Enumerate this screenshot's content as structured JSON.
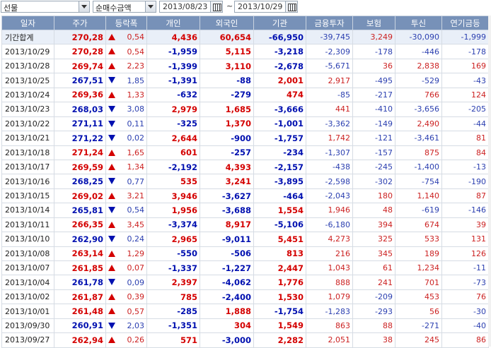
{
  "toolbar": {
    "market": "선물",
    "measure": "순매수금액",
    "start_date": "2013/08/23",
    "end_date": "2013/10/29",
    "range_sep": "~"
  },
  "table": {
    "headers": [
      "일자",
      "주가",
      "등락폭",
      "개인",
      "외국인",
      "기관",
      "금융투자",
      "보험",
      "투신",
      "연기금등"
    ],
    "colors": {
      "up": "#d40000",
      "down": "#0010b0",
      "header_bg": "#7791b8",
      "total_bg": "#e9eff8"
    },
    "rows": [
      {
        "date": "기간합계",
        "price": "270,28",
        "dir": "up",
        "chg": "0,54",
        "ind": "4,436",
        "for": "60,654",
        "inst": "-66,950",
        "fin": "-39,745",
        "ins": "3,249",
        "trust": "-30,090",
        "pension": "-1,999"
      },
      {
        "date": "2013/10/29",
        "price": "270,28",
        "dir": "up",
        "chg": "0,54",
        "ind": "-1,959",
        "for": "5,115",
        "inst": "-3,218",
        "fin": "-2,309",
        "ins": "-178",
        "trust": "-446",
        "pension": "-178"
      },
      {
        "date": "2013/10/28",
        "price": "269,74",
        "dir": "up",
        "chg": "2,23",
        "ind": "-1,399",
        "for": "3,110",
        "inst": "-2,678",
        "fin": "-5,671",
        "ins": "36",
        "trust": "2,838",
        "pension": "169"
      },
      {
        "date": "2013/10/25",
        "price": "267,51",
        "dir": "down",
        "chg": "1,85",
        "ind": "-1,391",
        "for": "-88",
        "inst": "2,001",
        "fin": "2,917",
        "ins": "-495",
        "trust": "-529",
        "pension": "-43"
      },
      {
        "date": "2013/10/24",
        "price": "269,36",
        "dir": "up",
        "chg": "1,33",
        "ind": "-632",
        "for": "-279",
        "inst": "474",
        "fin": "-85",
        "ins": "-217",
        "trust": "766",
        "pension": "124"
      },
      {
        "date": "2013/10/23",
        "price": "268,03",
        "dir": "down",
        "chg": "3,08",
        "ind": "2,979",
        "for": "1,685",
        "inst": "-3,666",
        "fin": "441",
        "ins": "-410",
        "trust": "-3,656",
        "pension": "-205"
      },
      {
        "date": "2013/10/22",
        "price": "271,11",
        "dir": "down",
        "chg": "0,11",
        "ind": "-325",
        "for": "1,370",
        "inst": "-1,001",
        "fin": "-3,362",
        "ins": "-149",
        "trust": "2,490",
        "pension": "-44"
      },
      {
        "date": "2013/10/21",
        "price": "271,22",
        "dir": "down",
        "chg": "0,02",
        "ind": "2,644",
        "for": "-900",
        "inst": "-1,757",
        "fin": "1,742",
        "ins": "-121",
        "trust": "-3,461",
        "pension": "81"
      },
      {
        "date": "2013/10/18",
        "price": "271,24",
        "dir": "up",
        "chg": "1,65",
        "ind": "601",
        "for": "-257",
        "inst": "-234",
        "fin": "-1,307",
        "ins": "-157",
        "trust": "875",
        "pension": "84"
      },
      {
        "date": "2013/10/17",
        "price": "269,59",
        "dir": "up",
        "chg": "1,34",
        "ind": "-2,192",
        "for": "4,393",
        "inst": "-2,157",
        "fin": "-438",
        "ins": "-245",
        "trust": "-1,400",
        "pension": "-13"
      },
      {
        "date": "2013/10/16",
        "price": "268,25",
        "dir": "down",
        "chg": "0,77",
        "ind": "535",
        "for": "3,241",
        "inst": "-3,895",
        "fin": "-2,598",
        "ins": "-302",
        "trust": "-754",
        "pension": "-190"
      },
      {
        "date": "2013/10/15",
        "price": "269,02",
        "dir": "up",
        "chg": "3,21",
        "ind": "3,946",
        "for": "-3,627",
        "inst": "-464",
        "fin": "-2,043",
        "ins": "180",
        "trust": "1,140",
        "pension": "87"
      },
      {
        "date": "2013/10/14",
        "price": "265,81",
        "dir": "down",
        "chg": "0,54",
        "ind": "1,956",
        "for": "-3,688",
        "inst": "1,554",
        "fin": "1,946",
        "ins": "48",
        "trust": "-619",
        "pension": "-146"
      },
      {
        "date": "2013/10/11",
        "price": "266,35",
        "dir": "up",
        "chg": "3,45",
        "ind": "-3,374",
        "for": "8,917",
        "inst": "-5,106",
        "fin": "-6,180",
        "ins": "394",
        "trust": "674",
        "pension": "39"
      },
      {
        "date": "2013/10/10",
        "price": "262,90",
        "dir": "down",
        "chg": "0,24",
        "ind": "2,965",
        "for": "-9,011",
        "inst": "5,451",
        "fin": "4,273",
        "ins": "325",
        "trust": "533",
        "pension": "131"
      },
      {
        "date": "2013/10/08",
        "price": "263,14",
        "dir": "up",
        "chg": "1,29",
        "ind": "-550",
        "for": "-506",
        "inst": "813",
        "fin": "216",
        "ins": "345",
        "trust": "189",
        "pension": "126"
      },
      {
        "date": "2013/10/07",
        "price": "261,85",
        "dir": "up",
        "chg": "0,07",
        "ind": "-1,337",
        "for": "-1,227",
        "inst": "2,447",
        "fin": "1,043",
        "ins": "61",
        "trust": "1,234",
        "pension": "-11"
      },
      {
        "date": "2013/10/04",
        "price": "261,78",
        "dir": "down",
        "chg": "0,09",
        "ind": "2,397",
        "for": "-4,062",
        "inst": "1,776",
        "fin": "888",
        "ins": "241",
        "trust": "701",
        "pension": "-73"
      },
      {
        "date": "2013/10/02",
        "price": "261,87",
        "dir": "up",
        "chg": "0,39",
        "ind": "785",
        "for": "-2,400",
        "inst": "1,530",
        "fin": "1,079",
        "ins": "-209",
        "trust": "453",
        "pension": "76"
      },
      {
        "date": "2013/10/01",
        "price": "261,48",
        "dir": "up",
        "chg": "0,57",
        "ind": "-285",
        "for": "1,888",
        "inst": "-1,754",
        "fin": "-1,283",
        "ins": "-293",
        "trust": "56",
        "pension": "-30"
      },
      {
        "date": "2013/09/30",
        "price": "260,91",
        "dir": "down",
        "chg": "2,03",
        "ind": "-1,351",
        "for": "304",
        "inst": "1,549",
        "fin": "863",
        "ins": "88",
        "trust": "-271",
        "pension": "-40"
      },
      {
        "date": "2013/09/27",
        "price": "262,94",
        "dir": "up",
        "chg": "0,26",
        "ind": "571",
        "for": "-3,000",
        "inst": "2,282",
        "fin": "2,051",
        "ins": "38",
        "trust": "245",
        "pension": "86"
      }
    ]
  }
}
